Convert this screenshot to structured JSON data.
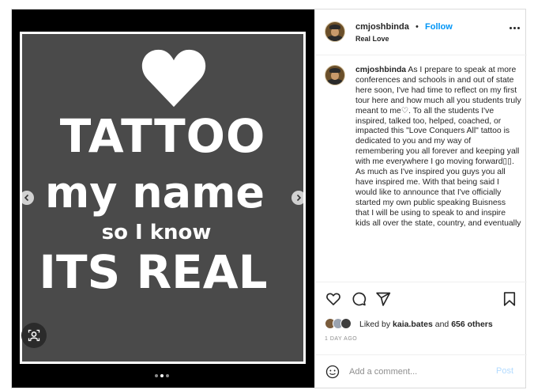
{
  "poster": {
    "line1": "TATTOO",
    "line2": "my name",
    "line3": "so I know",
    "line4": "ITS REAL"
  },
  "carousel": {
    "total_slides": 3,
    "active_slide": 2
  },
  "post_header": {
    "username": "cmjoshbinda",
    "separator": "•",
    "follow_label": "Follow",
    "location": "Real Love"
  },
  "caption": {
    "username": "cmjoshbinda",
    "text": "As I prepare to speak at more conferences and schools in and out of state here soon, I've had time to reflect on my first tour here and how much all you students truly meant to me♡. To all the students I've inspired, talked too, helped, coached, or impacted this \"Love Conquers All\" tattoo is dedicated to you and my way of remembering you all forever and keeping yall with me everywhere I go moving forward▯▯. As much as I've inspired you guys you all have inspired me. With that being said I would like to announce that I've officially started my own public speaking Buisness that I will be using to speak to and inspire kids all over the state, country, and eventually"
  },
  "likes": {
    "prefix": "Liked by",
    "user": "kaia.bates",
    "middle": "and",
    "others": "656 others"
  },
  "timestamp": "1 DAY AGO",
  "comment_box": {
    "placeholder": "Add a comment...",
    "post_label": "Post"
  },
  "colors": {
    "poster_bg": "#4a4a4a",
    "follow_blue": "#0095f6",
    "post_disabled": "#b3dbff",
    "media_bg": "#000000"
  },
  "icons": [
    "heart-icon",
    "comment-icon",
    "share-icon",
    "bookmark-icon",
    "more-icon",
    "emoji-icon",
    "tag-icon",
    "chevron-left-icon",
    "chevron-right-icon"
  ]
}
